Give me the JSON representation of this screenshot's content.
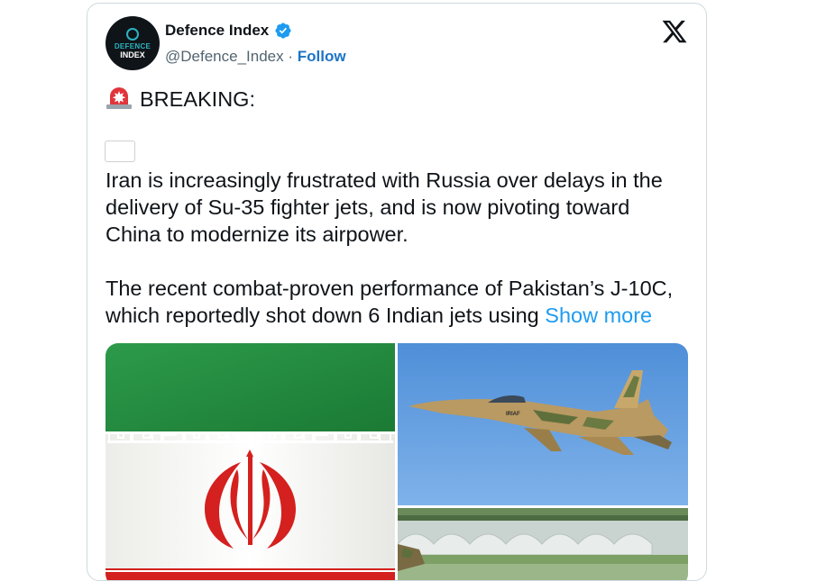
{
  "tweet": {
    "author": {
      "name": "Defence Index",
      "handle": "@Defence_Index",
      "separator": "·",
      "follow_label": "Follow",
      "avatar_text_top": "DEFENCE",
      "avatar_text_bottom": "INDEX",
      "verified_color": "#1d9bf0"
    },
    "platform_icon": "x-logo-icon",
    "body": {
      "heading": "BREAKING:",
      "paragraph1": "Iran is increasingly frustrated with Russia over delays in the delivery of Su-35 fighter jets, and is now pivoting toward China to modernize its airpower.",
      "paragraph2": "The recent combat-proven performance of Pakistan’s J-10C, which reportedly shot down 6 Indian jets using ",
      "show_more": "Show more"
    },
    "media": [
      {
        "name": "iran-flag-image"
      },
      {
        "name": "su-35-fighter-jet-image"
      },
      {
        "name": "fighter-jet-on-runway-image"
      }
    ],
    "jet_marking": "IRIAF"
  },
  "colors": {
    "link": "#1d9bf0",
    "follow": "#1d74c7",
    "secondary_text": "#536471",
    "border": "#cfd9de"
  }
}
